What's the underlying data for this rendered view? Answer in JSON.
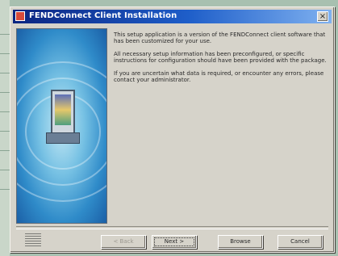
{
  "window": {
    "title": "FENDConnect Client Installation",
    "close_label": "×"
  },
  "content": {
    "paragraphs": [
      "This setup application is a version of the FENDConnect client software that has been customized for your use.",
      "All necessary setup information has been preconfigured, or specific instructions for configuration should have been provided with the package.",
      "If you are uncertain what data is required, or encounter any errors, please contact your administrator."
    ]
  },
  "buttons": {
    "back": "< Back",
    "next": "Next >",
    "browse": "Browse",
    "cancel": "Cancel"
  }
}
